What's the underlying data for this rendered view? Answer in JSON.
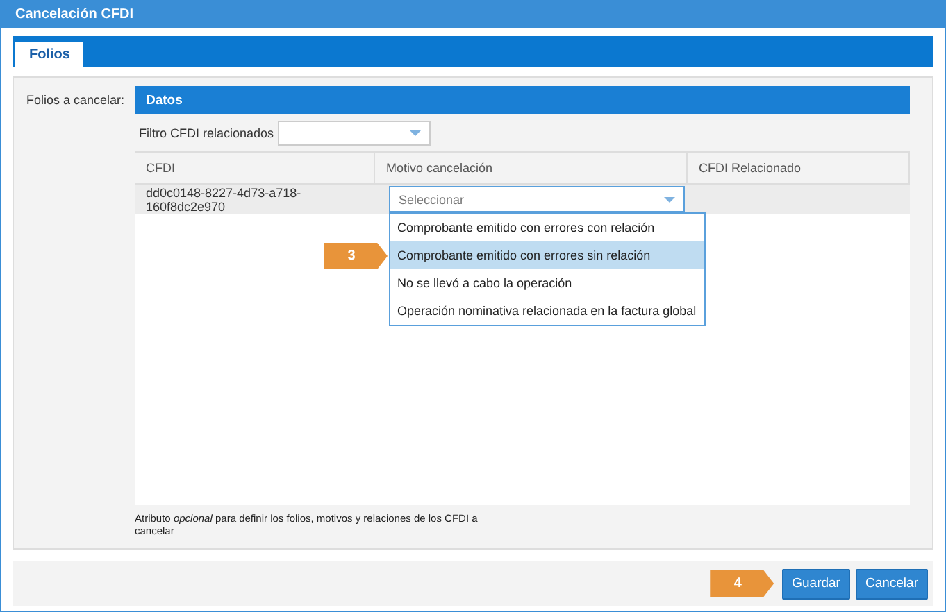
{
  "window": {
    "title": "Cancelación CFDI"
  },
  "tabs": [
    {
      "label": "Folios",
      "selected": true
    }
  ],
  "field_label": "Folios a cancelar:",
  "grid": {
    "title": "Datos",
    "filter_label": "Filtro CFDI relacionados",
    "columns": [
      "CFDI",
      "Motivo cancelación",
      "CFDI Relacionado"
    ],
    "rows": [
      {
        "cfdi": "dd0c0148-8227-4d73-a718-160f8dc2e970",
        "motivo": {
          "placeholder": "Seleccionar",
          "expanded": true
        }
      }
    ],
    "options": [
      {
        "label": "Comprobante emitido con errores con relación",
        "selected": false
      },
      {
        "label": "Comprobante emitido con errores sin relación",
        "selected": true
      },
      {
        "label": "No se llevó a cabo la operación",
        "selected": false
      },
      {
        "label": "Operación nominativa relacionada en la factura global",
        "selected": false
      }
    ],
    "note": "Atributo *opcional* para definir los folios, motivos y relaciones de los CFDI a cancelar"
  },
  "callouts": [
    {
      "label": "3"
    },
    {
      "label": "4"
    }
  ],
  "buttons": [
    {
      "label": "Guardar"
    },
    {
      "label": "Cancelar"
    }
  ]
}
